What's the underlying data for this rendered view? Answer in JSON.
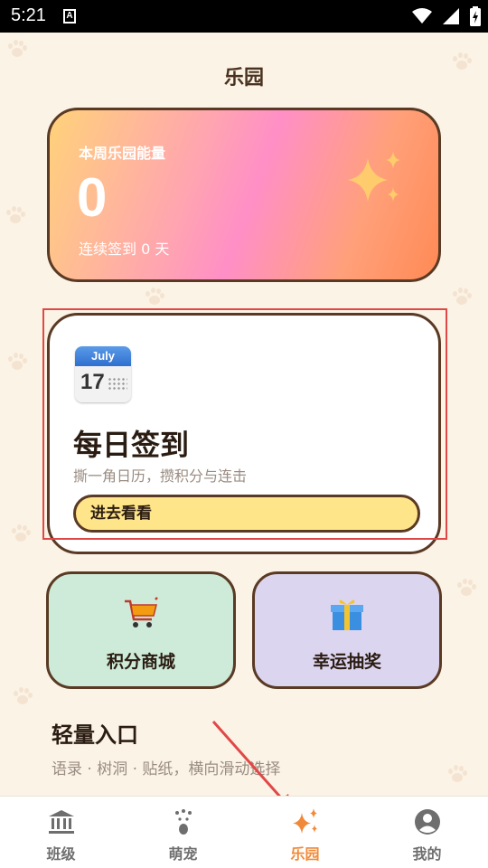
{
  "status": {
    "time": "5:21",
    "notif_glyph": "A"
  },
  "page": {
    "title": "乐园"
  },
  "energy": {
    "label": "本周乐园能量",
    "value": "0",
    "streak": "连续签到 0 天"
  },
  "checkin": {
    "calendar_month": "July",
    "calendar_day": "17",
    "title": "每日签到",
    "subtitle": "撕一角日历，攒积分与连击",
    "button": "进去看看"
  },
  "tiles": {
    "shop": "积分商城",
    "lottery": "幸运抽奖"
  },
  "light": {
    "title": "轻量入口",
    "subtitle": "语录 · 树洞 · 贴纸，横向滑动选择"
  },
  "nav": {
    "items": [
      {
        "label": "班级",
        "icon": "bank-icon"
      },
      {
        "label": "萌宠",
        "icon": "paw-icon"
      },
      {
        "label": "乐园",
        "icon": "sparkles-icon",
        "active": true
      },
      {
        "label": "我的",
        "icon": "profile-icon"
      }
    ]
  },
  "colors": {
    "accent": "#F08A3A",
    "background": "#FBF3E6",
    "border": "#5A3A24",
    "highlight": "#E04848"
  }
}
